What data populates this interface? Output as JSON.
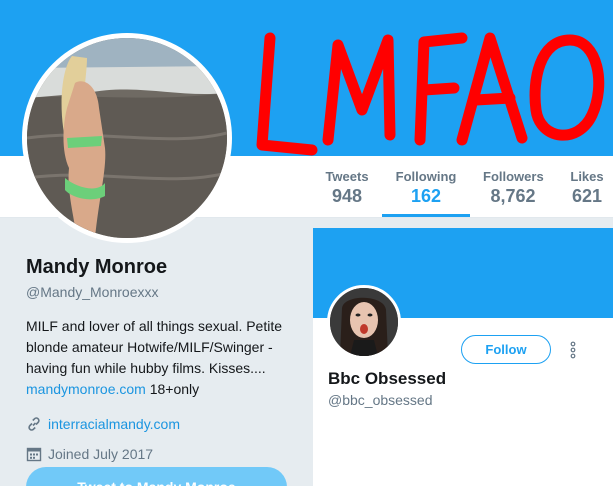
{
  "banner": {
    "overlay_text": "LMFAO",
    "overlay_color": "#ff0000",
    "color": "#1da1f2"
  },
  "stats": [
    {
      "label": "Tweets",
      "value": "948",
      "active": false
    },
    {
      "label": "Following",
      "value": "162",
      "active": true
    },
    {
      "label": "Followers",
      "value": "8,762",
      "active": false
    },
    {
      "label": "Likes",
      "value": "621",
      "active": false
    }
  ],
  "profile": {
    "name": "Mandy Monroe",
    "handle": "@Mandy_Monroexxx",
    "bio_text": "MILF and lover of all things sexual. Petite blonde amateur Hotwife/MILF/Swinger - having fun while hubby films. Kisses....",
    "bio_link": "mandymonroe.com",
    "bio_suffix": "18+only",
    "website": "interracialmandy.com",
    "joined": "Joined July 2017",
    "tweet_to_label": "Tweet to Mandy Monroe"
  },
  "follow_card": {
    "name": "Bbc Obsessed",
    "handle": "@bbc_obsessed",
    "follow_label": "Follow"
  },
  "colors": {
    "accent": "#1da1f2",
    "link": "#1b95e0",
    "muted": "#657786"
  }
}
